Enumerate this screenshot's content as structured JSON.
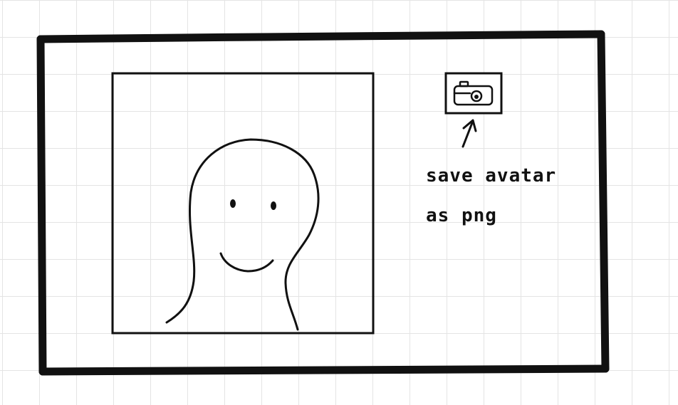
{
  "annotation": {
    "line1": "save avatar",
    "line2": "as png"
  },
  "icons": {
    "save_button": "camera-icon",
    "arrow": "arrow-up-icon",
    "avatar": "person-avatar-sketch"
  },
  "colors": {
    "ink": "#111111",
    "grid": "#e4e4e4",
    "paper": "#ffffff"
  }
}
